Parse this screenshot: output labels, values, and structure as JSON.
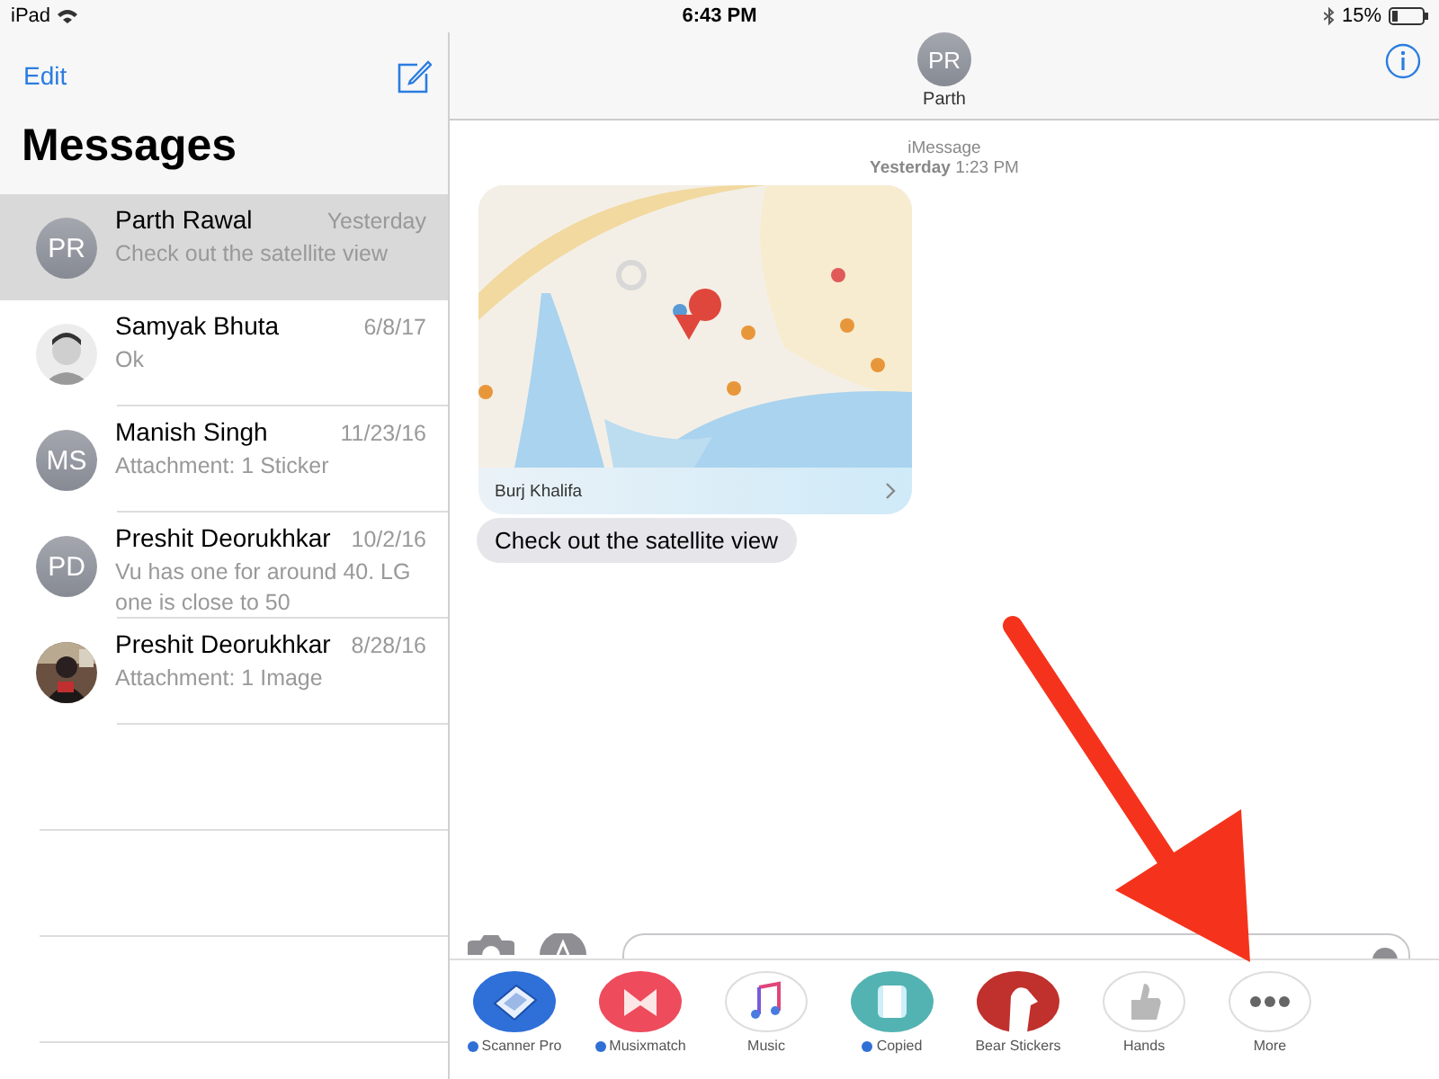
{
  "status_bar": {
    "device": "iPad",
    "time": "6:43 PM",
    "battery": "15%"
  },
  "sidebar": {
    "edit": "Edit",
    "title": "Messages",
    "conversations": [
      {
        "name": "Parth Rawal",
        "date": "Yesterday",
        "preview": "Check out the satellite view",
        "avatar": {
          "kind": "initials",
          "initials": "PR"
        },
        "selected": true
      },
      {
        "name": "Samyak Bhuta",
        "date": "6/8/17",
        "preview": "Ok",
        "selected": false
      },
      {
        "name": "Manish Singh",
        "date": "11/23/16",
        "preview": "Attachment: 1 Sticker",
        "avatar": {
          "kind": "initials",
          "initials": "MS"
        },
        "selected": false
      },
      {
        "name": "Preshit Deorukhkar",
        "date": "10/2/16",
        "preview": "Vu has one for around 40. LG one is close to 50",
        "avatar": {
          "kind": "initials",
          "initials": "PD"
        },
        "selected": false
      },
      {
        "name": "Preshit Deorukhkar",
        "date": "8/28/16",
        "preview": "Attachment: 1 Image",
        "selected": false
      }
    ]
  },
  "conversation": {
    "initials": "PR",
    "name": "Parth",
    "service": "iMessage",
    "timestamp": "**Yesterday** 1:23 PM",
    "map_card": {
      "kind": "picture",
      "caption": "Burj Khalifa"
    },
    "message": "Check out the satellite view"
  },
  "app_drawer": [
    {
      "kind": "scanner",
      "label": "Scanner Pro",
      "new": true
    },
    {
      "kind": "musixmatch",
      "label": "Musixmatch",
      "new": true
    },
    {
      "kind": "music",
      "label": "Music",
      "new": false
    },
    {
      "kind": "copied",
      "label": "Copied",
      "new": true
    },
    {
      "kind": "bear",
      "label": "Bear Stickers",
      "new": false
    },
    {
      "kind": "hands",
      "label": "Hands",
      "new": false
    },
    {
      "kind": "more",
      "label": "More",
      "new": false
    }
  ]
}
